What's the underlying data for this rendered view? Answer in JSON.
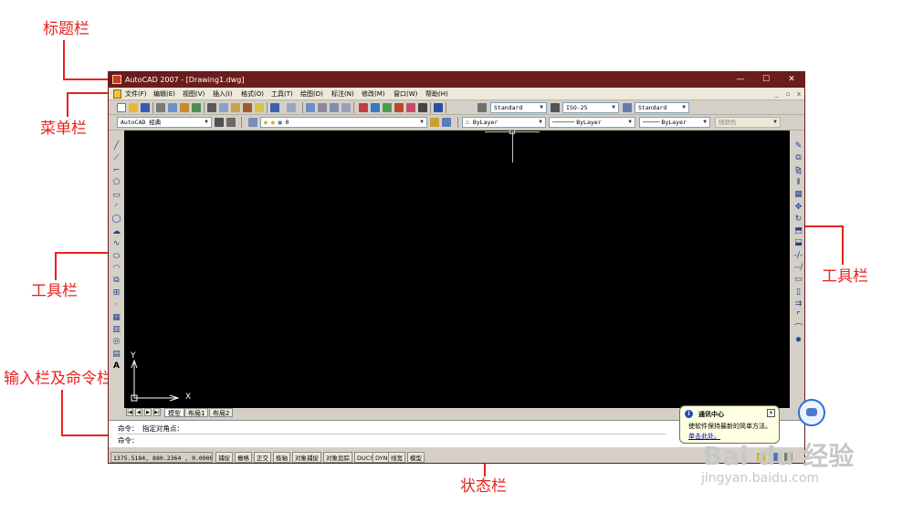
{
  "annotations": {
    "title_bar": "标题栏",
    "menu_bar": "菜单栏",
    "toolbar_left": "工具栏",
    "toolbar_right": "工具栏",
    "input_command_bar": "输入栏及命令栏",
    "status_bar": "状态栏"
  },
  "window": {
    "title": "AutoCAD 2007 - [Drawing1.dwg]",
    "minimize": "—",
    "maximize": "☐",
    "close": "✕"
  },
  "menu": {
    "items": [
      "文件(F)",
      "编辑(E)",
      "视图(V)",
      "插入(I)",
      "格式(O)",
      "工具(T)",
      "绘图(D)",
      "标注(N)",
      "修改(M)",
      "窗口(W)",
      "帮助(H)"
    ],
    "mdi_min": "_",
    "mdi_restore": "▫",
    "mdi_close": "x"
  },
  "toolbar_styles": {
    "text_style": "Standard",
    "dim_style": "ISO-25",
    "table_style": "Standard"
  },
  "toolbar_layers": {
    "workspace": "AutoCAD 经典",
    "layer": "0",
    "color": "ByLayer",
    "linetype": "ByLayer",
    "lineweight": "ByLayer",
    "plot_style": "随颜色"
  },
  "draw_tools_left": [
    "line-icon",
    "construction-line-icon",
    "polyline-icon",
    "polygon-icon",
    "rectangle-icon",
    "arc-icon",
    "circle-icon",
    "revision-cloud-icon",
    "spline-icon",
    "ellipse-icon",
    "ellipse-arc-icon",
    "insert-block-icon",
    "make-block-icon",
    "point-icon",
    "hatch-icon",
    "gradient-icon",
    "region-icon",
    "table-icon",
    "mtext-icon"
  ],
  "modify_tools_right": [
    "erase-icon",
    "copy-icon",
    "mirror-icon",
    "offset-icon",
    "array-icon",
    "move-icon",
    "rotate-icon",
    "scale-icon",
    "stretch-icon",
    "trim-icon",
    "extend-icon",
    "break-at-point-icon",
    "break-icon",
    "join-icon",
    "chamfer-icon",
    "fillet-icon",
    "explode-icon"
  ],
  "ucs": {
    "x_label": "X",
    "y_label": "Y"
  },
  "layout_tabs": {
    "model": "模型",
    "layout1": "布局1",
    "layout2": "布局2"
  },
  "command": {
    "history_line": "命令：  指定对角点：",
    "prompt": "命令："
  },
  "status": {
    "coordinates": "1375.5184, 880.2364 , 0.0000",
    "buttons": [
      "捕捉",
      "栅格",
      "正交",
      "极轴",
      "对象捕捉",
      "对象追踪",
      "DUCS",
      "DYN",
      "线宽",
      "模型"
    ]
  },
  "balloon": {
    "title": "通讯中心",
    "body": "使软件保持最新的简单方法。",
    "link": "单击此处。"
  },
  "watermark": {
    "brand": "Bai du 经验",
    "url": "jingyan.baidu.com"
  },
  "colors": {
    "annotation": "#e8221f",
    "titlebar": "#6b1c1c",
    "canvas": "#000000"
  }
}
